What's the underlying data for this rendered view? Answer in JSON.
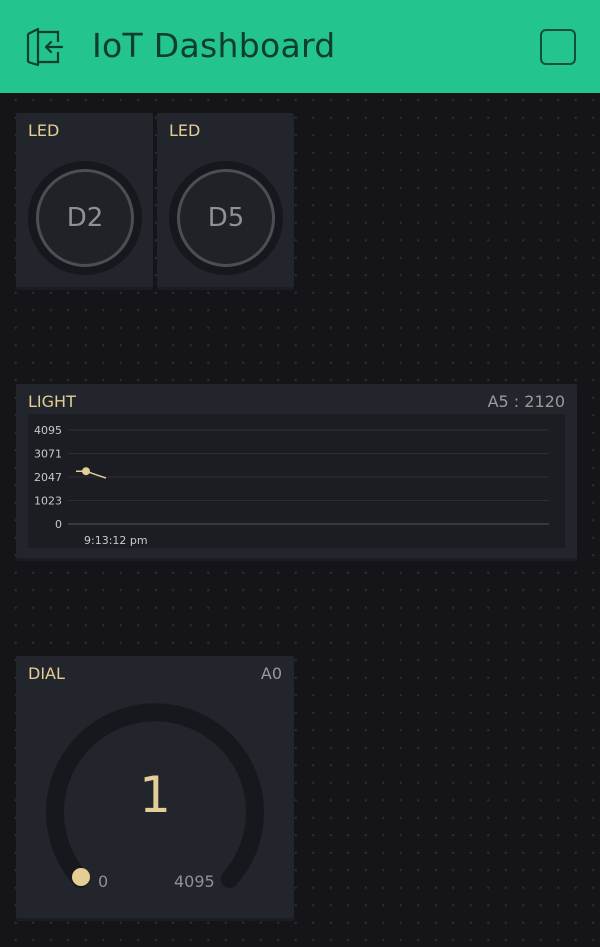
{
  "header": {
    "title": "IoT Dashboard",
    "back_icon": "exit-icon",
    "menu_icon": "square-icon",
    "background": "#23c48e"
  },
  "leds": [
    {
      "label": "LED",
      "pin": "D2"
    },
    {
      "label": "LED",
      "pin": "D5"
    }
  ],
  "light_chart": {
    "label": "LIGHT",
    "pin_value": "A5 : 2120",
    "time_label": "9:13:12 pm"
  },
  "dial": {
    "label": "DIAL",
    "pin": "A0",
    "value": "1",
    "min": "0",
    "max": "4095",
    "accent": "#e3cf96"
  },
  "chart_data": {
    "type": "line",
    "yticks": [
      "4095",
      "3071",
      "2047",
      "1023",
      "0"
    ],
    "ylim": [
      0,
      4095
    ],
    "series": [
      {
        "color": "#e3cf96",
        "values": [
          2300,
          2300,
          2150,
          2000
        ]
      }
    ],
    "grid": true
  }
}
